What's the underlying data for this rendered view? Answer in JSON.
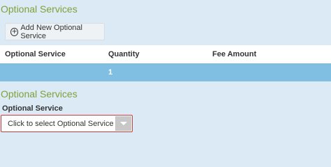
{
  "section_title": "Optional Services",
  "add_button": {
    "label": "Add New Optional Service",
    "icon": "plus-circle-icon"
  },
  "table": {
    "columns": [
      "Optional Service",
      "Quantity",
      "Fee Amount"
    ],
    "rows": [
      {
        "optional_service": "",
        "quantity": "1",
        "fee_amount": ""
      }
    ]
  },
  "form": {
    "title": "Optional Services",
    "field_label": "Optional Service",
    "select": {
      "placeholder": "Click to select Optional Service"
    }
  }
}
